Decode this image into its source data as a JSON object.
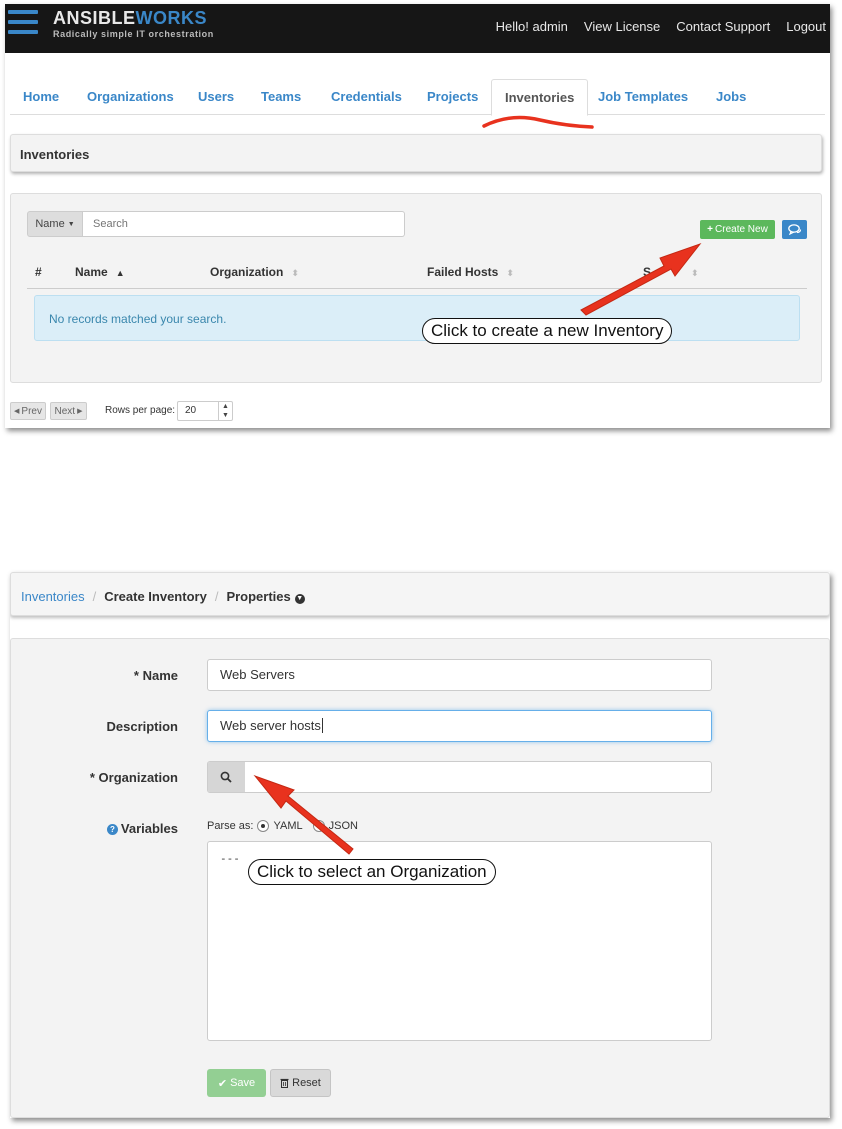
{
  "screen1": {
    "app": {
      "brand_part1": "ANSIBLE",
      "brand_part2": "WORKS",
      "tagline": "Radically simple IT orchestration"
    },
    "topnav": [
      "Hello! admin",
      "View License",
      "Contact Support",
      "Logout"
    ],
    "tabs": [
      {
        "label": "Home",
        "active": false
      },
      {
        "label": "Organizations",
        "active": false
      },
      {
        "label": "Users",
        "active": false
      },
      {
        "label": "Teams",
        "active": false
      },
      {
        "label": "Credentials",
        "active": false
      },
      {
        "label": "Projects",
        "active": false
      },
      {
        "label": "Inventories",
        "active": true
      },
      {
        "label": "Job Templates",
        "active": false
      },
      {
        "label": "Jobs",
        "active": false
      }
    ],
    "panel_title": "Inventories",
    "search": {
      "field_label": "Name",
      "placeholder": "Search"
    },
    "create_button": "Create New",
    "columns": [
      "#",
      "Name",
      "Organization",
      "Failed Hosts",
      "S"
    ],
    "empty_message": "No records matched your search.",
    "pagination": {
      "prev": "Prev",
      "next": "Next",
      "rows_label": "Rows per page:",
      "rows_value": "20"
    },
    "callout": "Click to create a new Inventory"
  },
  "screen2": {
    "breadcrumb": {
      "root": "Inventories",
      "middle": "Create Inventory",
      "current": "Properties"
    },
    "form": {
      "name_label": "* Name",
      "name_value": "Web Servers",
      "description_label": "Description",
      "description_value": "Web server hosts",
      "organization_label": "* Organization",
      "organization_value": "",
      "variables_label": "Variables",
      "parse_as_label": "Parse as:",
      "parse_options": [
        "YAML",
        "JSON"
      ],
      "parse_selected": "YAML",
      "variables_value": "---"
    },
    "buttons": {
      "save": "Save",
      "reset": "Reset"
    },
    "callout": "Click to select an Organization"
  },
  "colors": {
    "topbar": "#161616",
    "accent_blue": "#3a87c8",
    "success_green": "#5cb85c",
    "annotation_red": "#e8321e"
  }
}
